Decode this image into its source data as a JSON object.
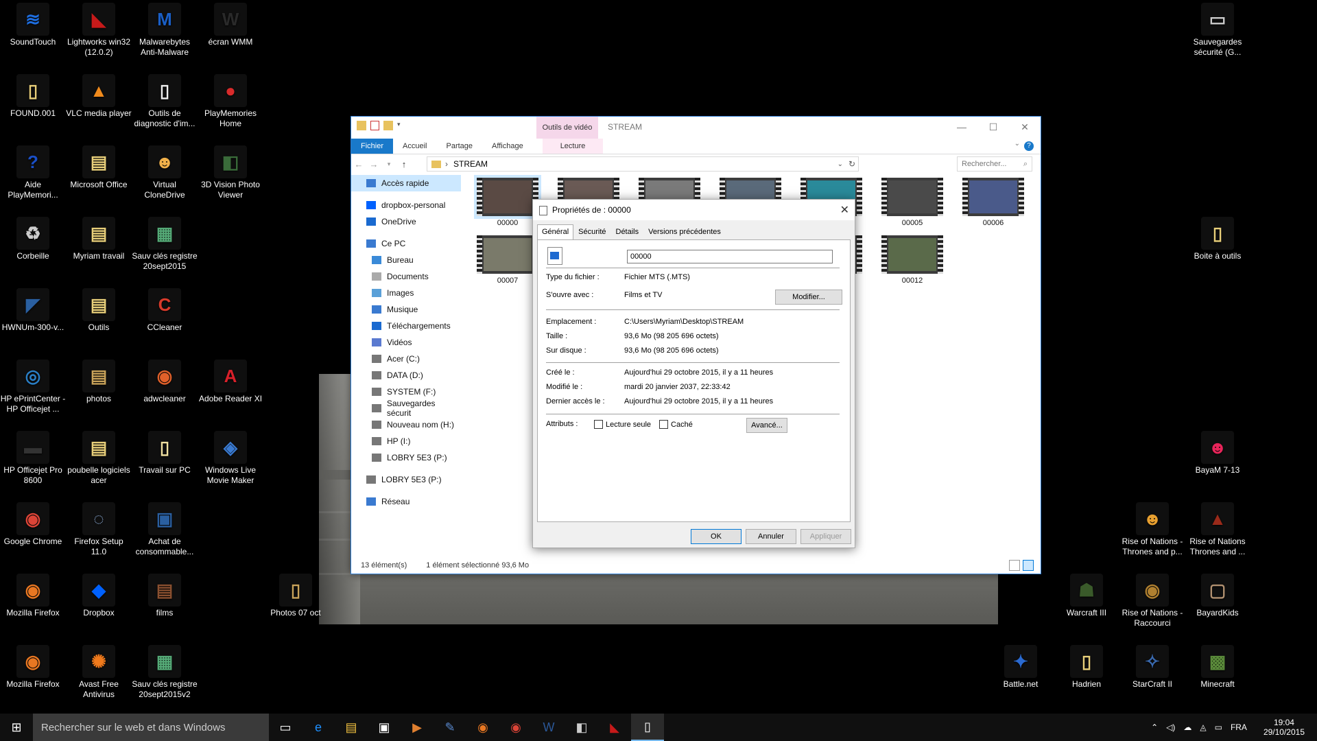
{
  "desktop": {
    "icons_left": [
      {
        "label": "SoundTouch",
        "glyph": "≋",
        "color": "#1e6ee0"
      },
      {
        "label": "Lightworks win32 (12.0.2)",
        "glyph": "◣",
        "color": "#c61a1a"
      },
      {
        "label": "Malwarebytes Anti-Malware",
        "glyph": "M",
        "color": "#1a5fc6"
      },
      {
        "label": "écran WMM",
        "glyph": "W",
        "color": "#2a2a2a"
      },
      {
        "label": "FOUND.001",
        "glyph": "▯",
        "color": "#e8cf7a"
      },
      {
        "label": "VLC media player",
        "glyph": "▲",
        "color": "#f08a1c"
      },
      {
        "label": "Outils de diagnostic d'im...",
        "glyph": "▯",
        "color": "#eeeeee"
      },
      {
        "label": "PlayMemories Home",
        "glyph": "●",
        "color": "#d92b2b"
      },
      {
        "label": "Aide PlayMemori...",
        "glyph": "?",
        "color": "#1a4fc6"
      },
      {
        "label": "Microsoft Office",
        "glyph": "▤",
        "color": "#e8cf7a"
      },
      {
        "label": "Virtual CloneDrive",
        "glyph": "☻",
        "color": "#f0b04a"
      },
      {
        "label": "3D Vision Photo Viewer",
        "glyph": "◧",
        "color": "#3a6b3a"
      },
      {
        "label": "Corbeille",
        "glyph": "♻",
        "color": "#cccccc"
      },
      {
        "label": "Myriam travail",
        "glyph": "▤",
        "color": "#e8cf7a"
      },
      {
        "label": "Sauv clés registre 20sept2015",
        "glyph": "▦",
        "color": "#55aa77"
      },
      {
        "label": "HWNUm-300-v...",
        "glyph": "◤",
        "color": "#2a5fa0"
      },
      {
        "label": "Outils",
        "glyph": "▤",
        "color": "#e8cf7a"
      },
      {
        "label": "CCleaner",
        "glyph": "C",
        "color": "#d93b2b"
      },
      {
        "label": "HP ePrintCenter - HP Officejet ...",
        "glyph": "◎",
        "color": "#2a7fc6"
      },
      {
        "label": "photos",
        "glyph": "▤",
        "color": "#c9a35a"
      },
      {
        "label": "adwcleaner",
        "glyph": "◉",
        "color": "#e0602a"
      },
      {
        "label": "Adobe Reader XI",
        "glyph": "A",
        "color": "#d9202a"
      },
      {
        "label": "HP Officejet Pro 8600",
        "glyph": "▬",
        "color": "#333333"
      },
      {
        "label": "poubelle logiciels acer",
        "glyph": "▤",
        "color": "#e8cf7a"
      },
      {
        "label": "Travail sur PC",
        "glyph": "▯",
        "color": "#f0e0a0"
      },
      {
        "label": "Windows Live Movie Maker",
        "glyph": "◈",
        "color": "#3a7ad0"
      },
      {
        "label": "Google Chrome",
        "glyph": "◉",
        "color": "#db4437"
      },
      {
        "label": "Firefox Setup 11.0",
        "glyph": "◌",
        "color": "#8aa8d0"
      },
      {
        "label": "Achat de consommable...",
        "glyph": "▣",
        "color": "#2a5fa0"
      },
      {
        "label": "Mozilla Firefox",
        "glyph": "◉",
        "color": "#e87722"
      },
      {
        "label": "Dropbox",
        "glyph": "◆",
        "color": "#0061fe"
      },
      {
        "label": "films",
        "glyph": "▤",
        "color": "#8a5030"
      },
      {
        "label": "Photos 07 oct",
        "glyph": "▯",
        "color": "#c9a35a"
      },
      {
        "label": "Mozilla Firefox",
        "glyph": "◉",
        "color": "#e87722"
      },
      {
        "label": "Avast Free Antivirus",
        "glyph": "✺",
        "color": "#f07a1c"
      },
      {
        "label": "Sauv clés registre 20sept2015v2",
        "glyph": "▦",
        "color": "#55aa77"
      }
    ],
    "icons_right": [
      {
        "label": "Sauvegardes sécurité (G...",
        "glyph": "▭",
        "color": "#cccccc"
      },
      {
        "label": "Boite à outils",
        "glyph": "▯",
        "color": "#e8cf7a"
      },
      {
        "label": "BayaM 7-13",
        "glyph": "☻",
        "color": "#e8255a"
      },
      {
        "label": "Rise of Nations - Thrones and p...",
        "glyph": "☻",
        "color": "#e8a030"
      },
      {
        "label": "Rise of Nations Thrones and ...",
        "glyph": "▲",
        "color": "#9a2a1a"
      },
      {
        "label": "Warcraft III",
        "glyph": "☗",
        "color": "#3a5a2a"
      },
      {
        "label": "Rise of Nations - Raccourci",
        "glyph": "◉",
        "color": "#b08030"
      },
      {
        "label": "BayardKids",
        "glyph": "▢",
        "color": "#b09070"
      },
      {
        "label": "Battle.net",
        "glyph": "✦",
        "color": "#2a6ad0"
      },
      {
        "label": "Hadrien",
        "glyph": "▯",
        "color": "#e8cf7a"
      },
      {
        "label": "StarCraft II",
        "glyph": "✧",
        "color": "#3a6ab0"
      },
      {
        "label": "Minecraft",
        "glyph": "▩",
        "color": "#5a8a3a"
      }
    ]
  },
  "explorer": {
    "context_tab": "Outils de vidéo",
    "title": "STREAM",
    "ribbon_tabs": [
      "Fichier",
      "Accueil",
      "Partage",
      "Affichage",
      "Lecture"
    ],
    "path_sep": "›",
    "path": "STREAM",
    "search_placeholder": "Rechercher...",
    "nav": [
      {
        "label": "Accès rapide",
        "sel": true,
        "sub": false,
        "color": "#3a7ad0"
      },
      {
        "label": "dropbox-personal",
        "sel": false,
        "sub": false,
        "color": "#0061fe"
      },
      {
        "label": "OneDrive",
        "sel": false,
        "sub": false,
        "color": "#1a6ad0"
      },
      {
        "label": "Ce PC",
        "sel": false,
        "sub": false,
        "color": "#3a7ad0"
      },
      {
        "label": "Bureau",
        "sel": false,
        "sub": true,
        "color": "#3a8ad8"
      },
      {
        "label": "Documents",
        "sel": false,
        "sub": true,
        "color": "#aaaaaa"
      },
      {
        "label": "Images",
        "sel": false,
        "sub": true,
        "color": "#5aa0d8"
      },
      {
        "label": "Musique",
        "sel": false,
        "sub": true,
        "color": "#3a7ad0"
      },
      {
        "label": "Téléchargements",
        "sel": false,
        "sub": true,
        "color": "#1a6ad0"
      },
      {
        "label": "Vidéos",
        "sel": false,
        "sub": true,
        "color": "#5a7ad0"
      },
      {
        "label": "Acer (C:)",
        "sel": false,
        "sub": true,
        "color": "#777777"
      },
      {
        "label": "DATA (D:)",
        "sel": false,
        "sub": true,
        "color": "#777777"
      },
      {
        "label": "SYSTEM (F:)",
        "sel": false,
        "sub": true,
        "color": "#777777"
      },
      {
        "label": "Sauvegardes sécurit",
        "sel": false,
        "sub": true,
        "color": "#777777"
      },
      {
        "label": "Nouveau nom (H:)",
        "sel": false,
        "sub": true,
        "color": "#777777"
      },
      {
        "label": "HP (I:)",
        "sel": false,
        "sub": true,
        "color": "#777777"
      },
      {
        "label": "LOBRY 5E3 (P:)",
        "sel": false,
        "sub": true,
        "color": "#777777"
      },
      {
        "label": "LOBRY 5E3 (P:)",
        "sel": false,
        "sub": false,
        "color": "#777777"
      },
      {
        "label": "Réseau",
        "sel": false,
        "sub": false,
        "color": "#3a7ad0"
      }
    ],
    "thumbnails": [
      {
        "label": "00000",
        "sel": true,
        "frame": "#5a4a44"
      },
      {
        "label": "",
        "sel": false,
        "frame": "#6a5a55"
      },
      {
        "label": "",
        "sel": false,
        "frame": "#7a7a7a"
      },
      {
        "label": "",
        "sel": false,
        "frame": "#5a6a7a"
      },
      {
        "label": "",
        "sel": false,
        "frame": "#2a8a9a"
      },
      {
        "label": "00005",
        "sel": false,
        "frame": "#4a4a4a"
      },
      {
        "label": "00006",
        "sel": false,
        "frame": "#4a5a8a"
      },
      {
        "label": "00007",
        "sel": false,
        "frame": "#7a7a6a"
      },
      {
        "label": "",
        "sel": false,
        "frame": "#4a4a4a"
      },
      {
        "label": "",
        "sel": false,
        "frame": "#4a4a4a"
      },
      {
        "label": "",
        "sel": false,
        "frame": "#4a4a4a"
      },
      {
        "label": "",
        "sel": false,
        "frame": "#4a4a4a"
      },
      {
        "label": "00012",
        "sel": false,
        "frame": "#5a6a4a"
      }
    ],
    "status_count": "13 élément(s)",
    "status_sel": "1 élément sélectionné  93,6 Mo"
  },
  "props": {
    "title": "Propriétés de : 00000",
    "tabs": [
      "Général",
      "Sécurité",
      "Détails",
      "Versions précédentes"
    ],
    "name": "00000",
    "type_k": "Type du fichier :",
    "type_v": "Fichier MTS (.MTS)",
    "opens_k": "S'ouvre avec :",
    "opens_v": "Films et TV",
    "modify": "Modifier...",
    "loc_k": "Emplacement :",
    "loc_v": "C:\\Users\\Myriam\\Desktop\\STREAM",
    "size_k": "Taille :",
    "size_v": "93,6 Mo (98 205 696 octets)",
    "disk_k": "Sur disque :",
    "disk_v": "93,6 Mo (98 205 696 octets)",
    "created_k": "Créé le :",
    "created_v": "Aujourd'hui 29 octobre 2015, il y a 11 heures",
    "modified_k": "Modifié le :",
    "modified_v": "mardi 20 janvier 2037, 22:33:42",
    "access_k": "Dernier accès le :",
    "access_v": "Aujourd'hui 29 octobre 2015, il y a 11 heures",
    "attr_k": "Attributs :",
    "readonly": "Lecture seule",
    "hidden": "Caché",
    "advanced": "Avancé...",
    "ok": "OK",
    "cancel": "Annuler",
    "apply": "Appliquer"
  },
  "taskbar": {
    "search_placeholder": "Rechercher sur le web et dans Windows",
    "icons": [
      {
        "name": "task-view-icon",
        "glyph": "▭",
        "color": "#ffffff"
      },
      {
        "name": "edge-icon",
        "glyph": "e",
        "color": "#1e90ff"
      },
      {
        "name": "file-explorer-icon",
        "glyph": "▤",
        "color": "#f0c040"
      },
      {
        "name": "store-icon",
        "glyph": "▣",
        "color": "#ffffff"
      },
      {
        "name": "media-player-icon",
        "glyph": "▶",
        "color": "#e08030"
      },
      {
        "name": "tool-icon",
        "glyph": "✎",
        "color": "#5a8ad0"
      },
      {
        "name": "firefox-icon",
        "glyph": "◉",
        "color": "#e87722"
      },
      {
        "name": "chrome-icon",
        "glyph": "◉",
        "color": "#db4437"
      },
      {
        "name": "word-icon",
        "glyph": "W",
        "color": "#2b5797"
      },
      {
        "name": "media-icon",
        "glyph": "◧",
        "color": "#cccccc"
      },
      {
        "name": "lightworks-icon",
        "glyph": "◣",
        "color": "#c61a1a"
      },
      {
        "name": "properties-icon",
        "glyph": "▯",
        "color": "#ffffff"
      }
    ],
    "tray_lang": "FRA",
    "time": "19:04",
    "date": "29/10/2015"
  }
}
